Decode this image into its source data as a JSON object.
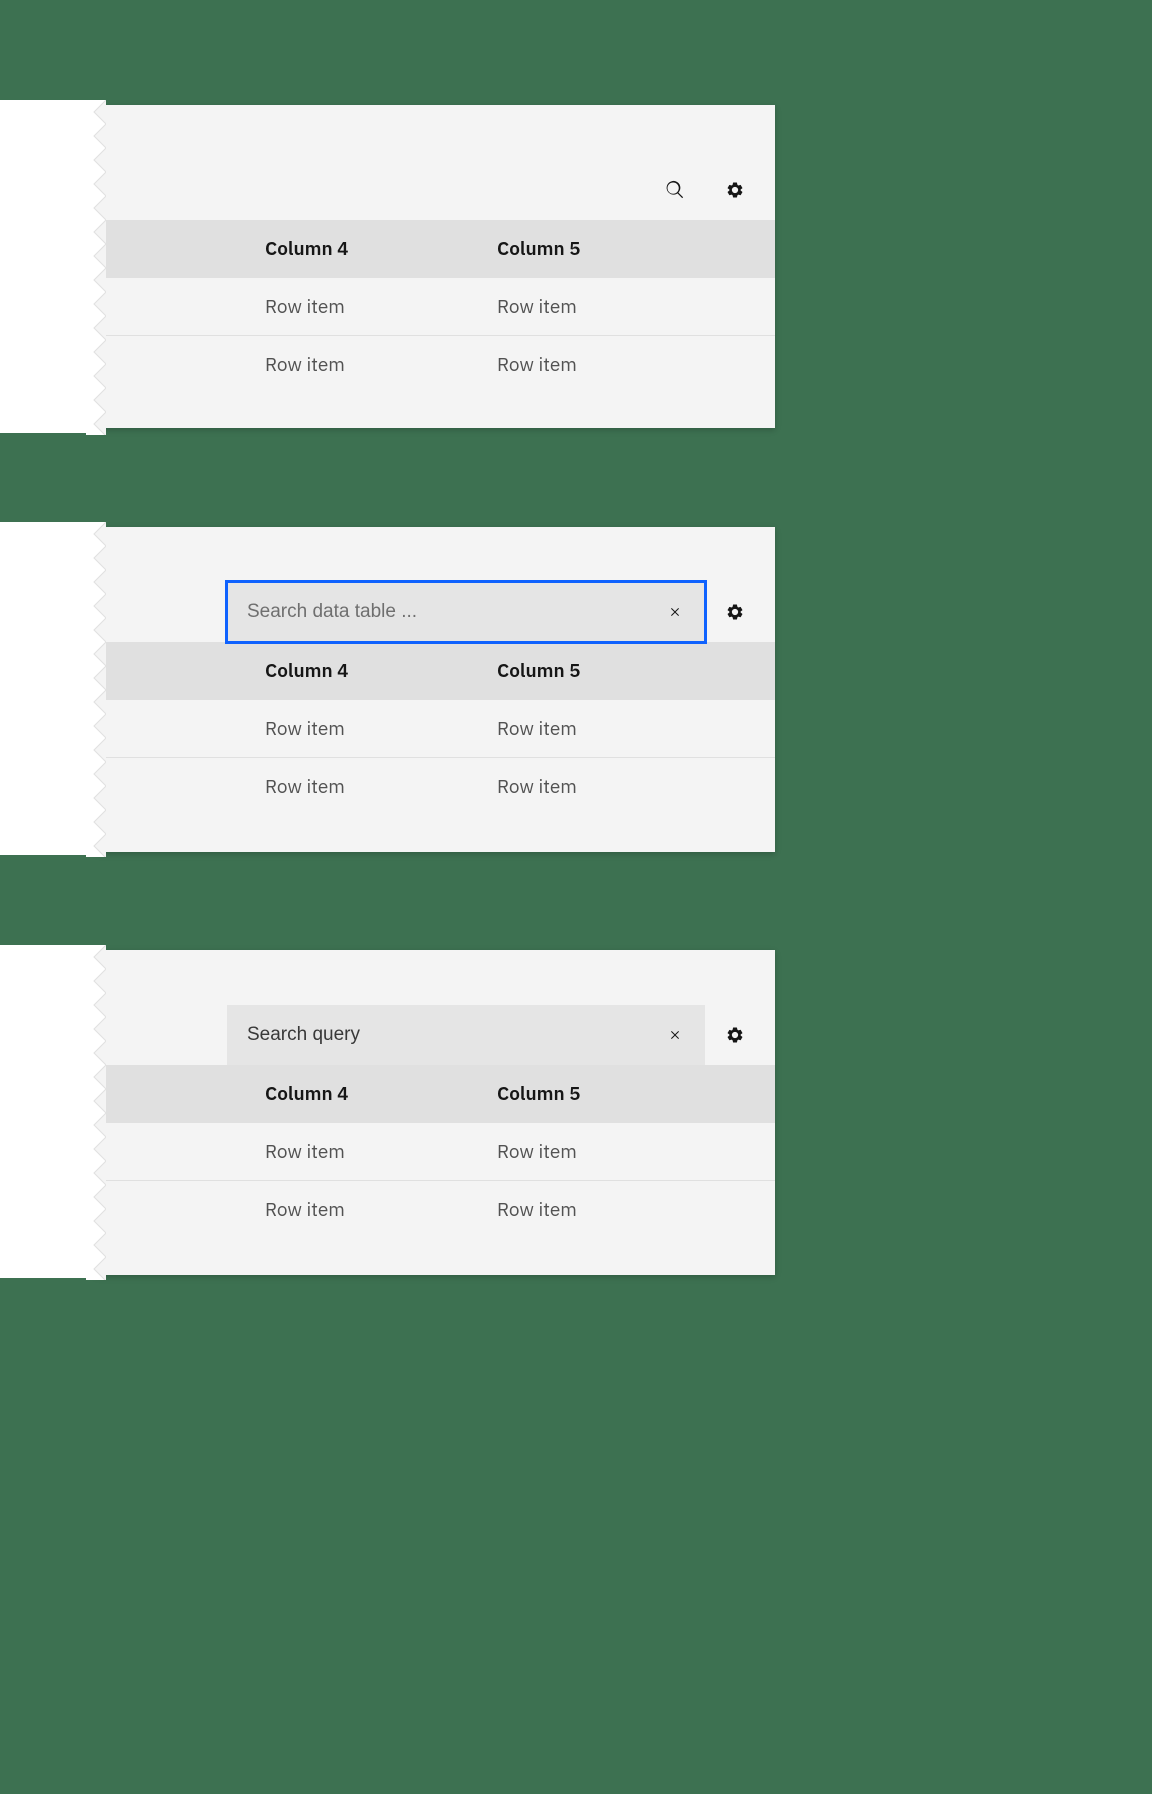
{
  "table": {
    "headers": {
      "partial": "3",
      "col4": "Column 4",
      "col5": "Column 5"
    },
    "rows": [
      {
        "partial": "n",
        "c4": "Row item",
        "c5": "Row item"
      },
      {
        "partial": "n",
        "c4": "Row item",
        "c5": "Row item"
      }
    ]
  },
  "search": {
    "placeholder": "Search data table ...",
    "query_value": "Search query"
  },
  "icons": {
    "search": "search-icon",
    "settings": "settings-icon",
    "close": "close-icon"
  }
}
